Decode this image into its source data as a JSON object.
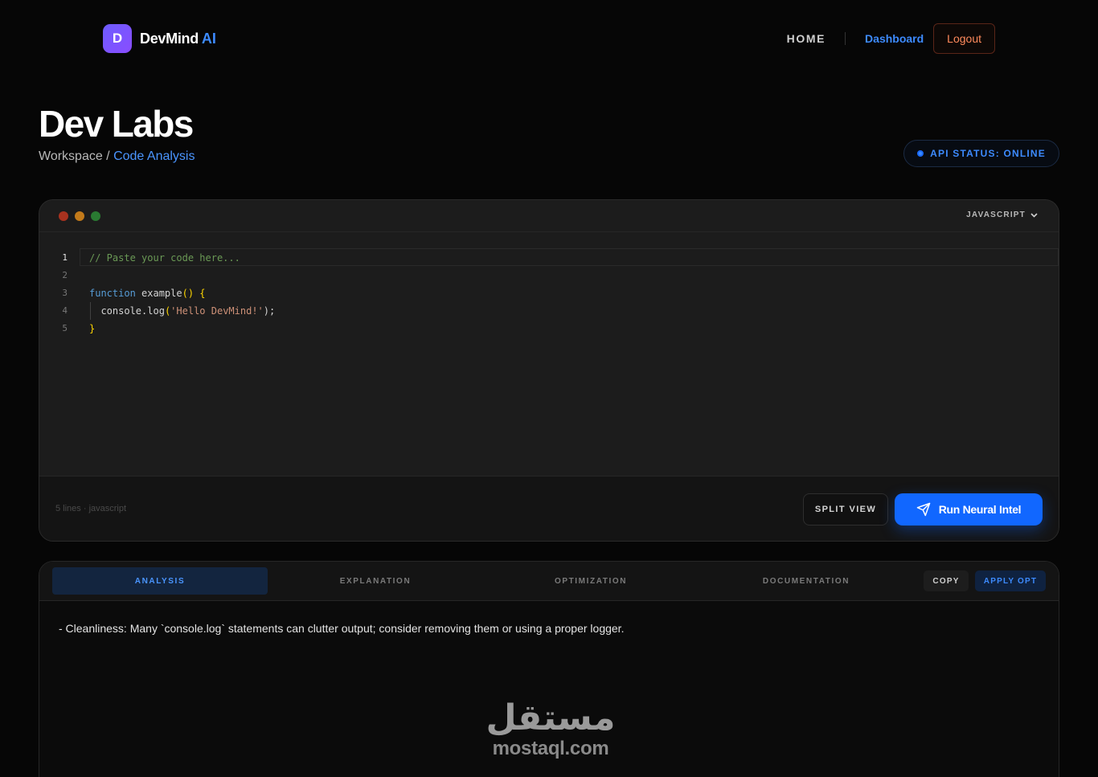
{
  "brand": {
    "initial": "D",
    "name": "DevMind",
    "accent": "AI"
  },
  "nav": {
    "home": "HOME",
    "dashboard": "Dashboard",
    "logout": "Logout"
  },
  "page": {
    "title": "Dev Labs",
    "crumb_root": "Workspace",
    "crumb_sep": " / ",
    "crumb_active": "Code Analysis"
  },
  "api_status": "API STATUS: ONLINE",
  "editor": {
    "language": "JAVASCRIPT",
    "line_numbers": [
      "1",
      "2",
      "3",
      "4",
      "5"
    ],
    "code": {
      "l1_comment": "// Paste your code here...",
      "l3_kw": "function",
      "l3_name": " example",
      "l3_paren": "()",
      "l3_brace": " {",
      "l4_indent": "  ",
      "l4_call": "console.log",
      "l4_open": "(",
      "l4_str": "'Hello DevMind!'",
      "l4_close": ");",
      "l5_brace": "}"
    },
    "footer_meta": "5 lines · javascript",
    "split_view": "SPLIT VIEW",
    "run": "Run Neural Intel"
  },
  "results": {
    "tabs": [
      "ANALYSIS",
      "EXPLANATION",
      "OPTIMIZATION",
      "DOCUMENTATION"
    ],
    "active_tab": "ANALYSIS",
    "copy": "COPY",
    "apply": "APPLY OPT",
    "text": "- Cleanliness: Many `console.log` statements can clutter output; consider removing them or using a proper logger."
  },
  "watermark": {
    "arabic": "مستقل",
    "latin": "mostaql.com"
  },
  "colors": {
    "accent": "#3d8bff",
    "run_button": "#1167ff",
    "logout": "#ff8a5c",
    "background": "#060606"
  }
}
